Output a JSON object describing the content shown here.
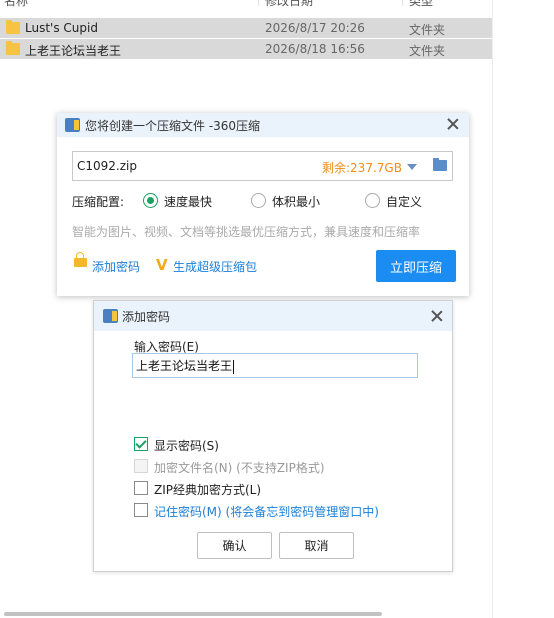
{
  "explorer": {
    "columns": [
      "名称",
      "修改日期",
      "类型"
    ],
    "rows": [
      {
        "name": "Lust's Cupid",
        "date": "2026/8/17 20:26",
        "type": "文件夹"
      },
      {
        "name": "上老王论坛当老王",
        "date": "2026/8/18 16:56",
        "type": "文件夹"
      }
    ]
  },
  "compress_dialog": {
    "title": "您将创建一个压缩文件 -360压缩",
    "filename": "C1092.zip",
    "free_space": "剩余:237.7GB",
    "config_label": "压缩配置:",
    "options": [
      "速度最快",
      "体积最小",
      "自定义"
    ],
    "selected_option": "速度最快",
    "hint": "智能为图片、视频、文档等挑选最优压缩方式，兼具速度和压缩率",
    "add_password": "添加密码",
    "super_package": "生成超级压缩包",
    "compress_now": "立即压缩"
  },
  "password_dialog": {
    "title": "添加密码",
    "input_label": "输入密码(E)",
    "password_value": "上老王论坛当老王",
    "show_password": "显示密码(S)",
    "encrypt_filenames": "加密文件名(N) (不支持ZIP格式)",
    "zip_classic": "ZIP经典加密方式(L)",
    "remember_password": "记住密码(M) (将会备忘到密码管理窗口中)",
    "ok": "确认",
    "cancel": "取消"
  }
}
